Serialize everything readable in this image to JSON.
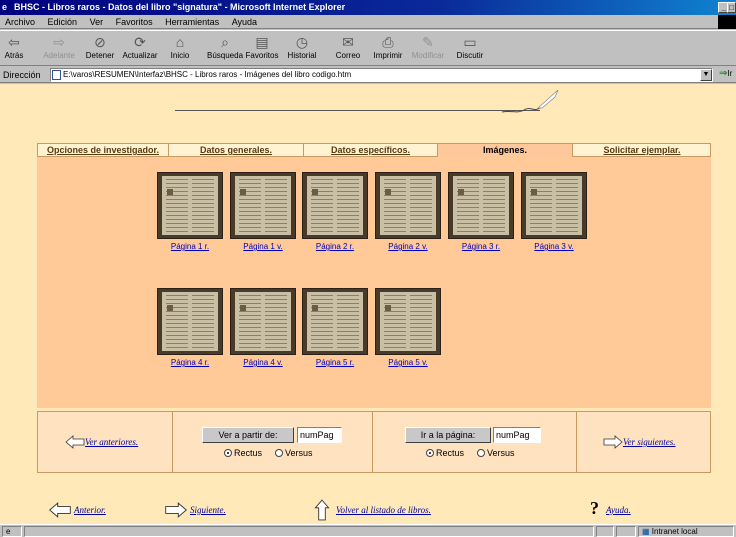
{
  "window": {
    "title": "BHSC - Libros raros - Datos del libro \"signatura\" - Microsoft Internet Explorer",
    "controls": [
      "_",
      "□"
    ]
  },
  "menu": [
    "Archivo",
    "Edición",
    "Ver",
    "Favoritos",
    "Herramientas",
    "Ayuda"
  ],
  "toolbar": [
    {
      "label": "Atrás",
      "icon": "back-arrow-icon",
      "glyph": "⇦",
      "enabled": true
    },
    {
      "label": "Adelante",
      "icon": "forward-arrow-icon",
      "glyph": "⇨",
      "enabled": false
    },
    {
      "label": "Detener",
      "icon": "stop-icon",
      "glyph": "⊘",
      "enabled": true
    },
    {
      "label": "Actualizar",
      "icon": "refresh-icon",
      "glyph": "⟳",
      "enabled": true
    },
    {
      "label": "Inicio",
      "icon": "home-icon",
      "glyph": "⌂",
      "enabled": true
    },
    {
      "label": "Búsqueda",
      "icon": "search-icon",
      "glyph": "⌕",
      "enabled": true
    },
    {
      "label": "Favoritos",
      "icon": "favorites-icon",
      "glyph": "▤",
      "enabled": true
    },
    {
      "label": "Historial",
      "icon": "history-icon",
      "glyph": "◷",
      "enabled": true
    },
    {
      "label": "Correo",
      "icon": "mail-icon",
      "glyph": "✉",
      "enabled": true
    },
    {
      "label": "Imprimir",
      "icon": "print-icon",
      "glyph": "⎙",
      "enabled": true
    },
    {
      "label": "Modificar",
      "icon": "edit-icon",
      "glyph": "✎",
      "enabled": false
    },
    {
      "label": "Discutir",
      "icon": "discuss-icon",
      "glyph": "▭",
      "enabled": true
    }
  ],
  "address": {
    "label": "Dirección",
    "value": "E:\\varos\\RESUMEN\\Interfaz\\BHSC - Libros raros - Imágenes del libro codigo.htm",
    "go_label": "Ir"
  },
  "tabs": [
    {
      "label": "Opciones de investigador.",
      "active": false
    },
    {
      "label": "Datos generales.",
      "active": false
    },
    {
      "label": "Datos específicos.",
      "active": false
    },
    {
      "label": "Imágenes.",
      "active": true
    },
    {
      "label": "Solicitar ejemplar.",
      "active": false
    }
  ],
  "thumbnails": [
    {
      "label": "Página 1 r."
    },
    {
      "label": "Página 1 v."
    },
    {
      "label": "Página 2 r."
    },
    {
      "label": "Página 2 v."
    },
    {
      "label": "Página 3 r."
    },
    {
      "label": "Página 3 v."
    },
    {
      "label": "Página 4 r."
    },
    {
      "label": "Página 4 v."
    },
    {
      "label": "Página 5 r."
    },
    {
      "label": "Página 5 v."
    }
  ],
  "pager": {
    "prev_label": "Ver anteriores.",
    "next_label": "Ver siguientes.",
    "from_button": "Ver a partir de:",
    "from_value": "numPag",
    "goto_button": "Ir a la página:",
    "goto_value": "numPag",
    "rectus": "Rectus",
    "versus": "Versus"
  },
  "bottom_nav": {
    "previous": "Anterior.",
    "next": "Siguiente.",
    "back_to_list": "Volver al listado de libros.",
    "help": "Ayuda.",
    "help_glyph": "?"
  },
  "status": {
    "zone": "Intranet local"
  }
}
